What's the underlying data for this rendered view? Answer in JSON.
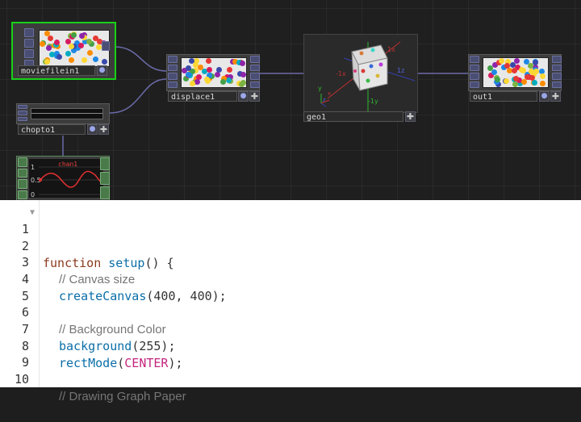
{
  "network": {
    "nodes": {
      "moviefilein": {
        "label": "moviefilein1"
      },
      "displace": {
        "label": "displace1"
      },
      "geo": {
        "label": "geo1"
      },
      "out": {
        "label": "out1"
      },
      "chopto": {
        "label": "chopto1"
      }
    },
    "geo_viewport": {
      "axis_labels": [
        "-1x",
        "1x",
        "-1y",
        "y",
        "1z",
        "z",
        "x"
      ]
    },
    "chop_viewer": {
      "channel": "chan1",
      "ticks": [
        "1",
        "0.5",
        "0"
      ]
    },
    "colors": {
      "selected_border": "#18d018",
      "node_tile": "#3c3c3c",
      "rail": "#4a4e73",
      "wire": "#6a6aa8",
      "grid_bg": "#1f1f1f"
    }
  },
  "editor": {
    "lines": [
      {
        "number": "1",
        "code": "function setup() {"
      },
      {
        "number": "2",
        "code": ""
      },
      {
        "number": "3",
        "code": "  // Canvas size"
      },
      {
        "number": "4",
        "code": "  createCanvas(400, 400);"
      },
      {
        "number": "5",
        "code": ""
      },
      {
        "number": "6",
        "code": "  // Background Color"
      },
      {
        "number": "7",
        "code": "  background(255);"
      },
      {
        "number": "8",
        "code": "  rectMode(CENTER);"
      },
      {
        "number": "9",
        "code": ""
      },
      {
        "number": "10",
        "code": "  // Drawing Graph Paper"
      }
    ],
    "tokens": {
      "l1_kw": "function",
      "l1_fn": "setup",
      "l1_rest": "() {",
      "l3": "// Canvas size",
      "l4_fn": "createCanvas",
      "l4_rest": "(400, 400);",
      "l6": "// Background Color",
      "l7_fn": "background",
      "l7_rest": "(255);",
      "l8_fn": "rectMode",
      "l8_open": "(",
      "l8_const": "CENTER",
      "l8_close": ");",
      "l10": "// Drawing Graph Paper"
    },
    "colors": {
      "keyword": "#8b3a1e",
      "function": "#0b6ea8",
      "constant": "#c4267f",
      "comment": "#757575"
    }
  }
}
